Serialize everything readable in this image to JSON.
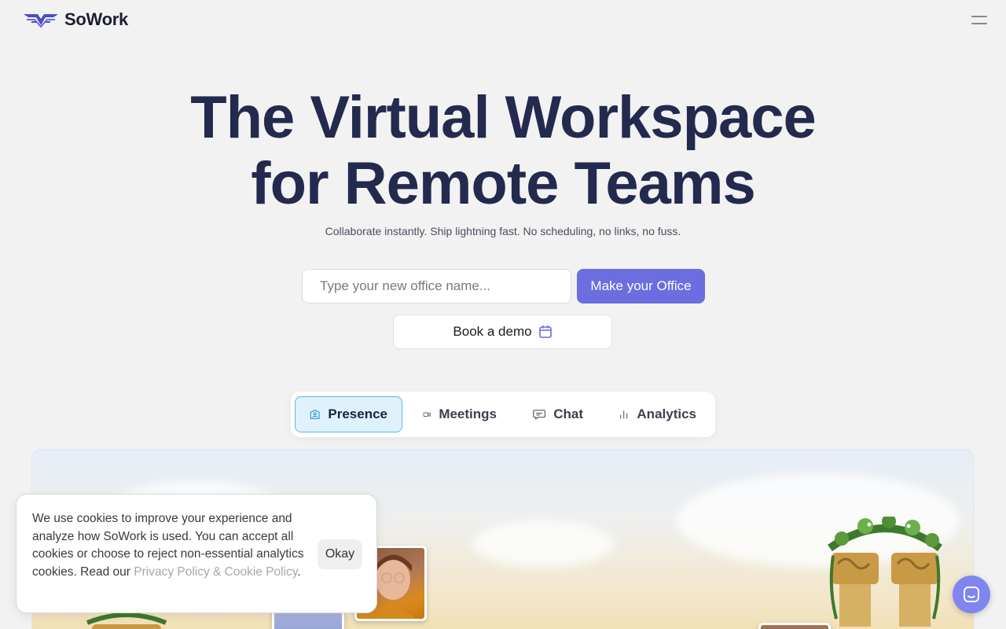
{
  "header": {
    "brand": "SoWork",
    "logo_icon": "sowork-wings-logo",
    "menu_icon": "hamburger-menu-icon"
  },
  "hero": {
    "title_line1": "The Virtual Workspace",
    "title_line2": "for Remote Teams",
    "subtitle": "Collaborate instantly. Ship lightning fast. No scheduling, no links, no fuss."
  },
  "cta": {
    "office_input_placeholder": "Type your new office name...",
    "office_input_value": "",
    "make_office_label": "Make your Office",
    "book_demo_label": "Book a demo",
    "book_demo_icon": "calendar-icon"
  },
  "tabs": [
    {
      "label": "Presence",
      "icon": "office-building-icon",
      "active": true
    },
    {
      "label": "Meetings",
      "icon": "video-camera-icon",
      "active": false
    },
    {
      "label": "Chat",
      "icon": "chat-bubble-icon",
      "active": false
    },
    {
      "label": "Analytics",
      "icon": "bar-chart-icon",
      "active": false
    }
  ],
  "cookie_banner": {
    "text": "We use cookies to improve your experience and analyze how SoWork is used. You can accept all cookies or choose to reject non-essential analytics cookies. Read our ",
    "link_text": "Privacy Policy & Cookie Policy",
    "suffix": ".",
    "okay_label": "Okay"
  },
  "chat_launcher": {
    "icon": "chat-launcher-icon"
  },
  "colors": {
    "accent": "#6b6de0",
    "title": "#232a4e",
    "active_tab_bg": "#dff2fb",
    "active_tab_border": "#5cb8e6",
    "launcher": "#7f86f0"
  }
}
